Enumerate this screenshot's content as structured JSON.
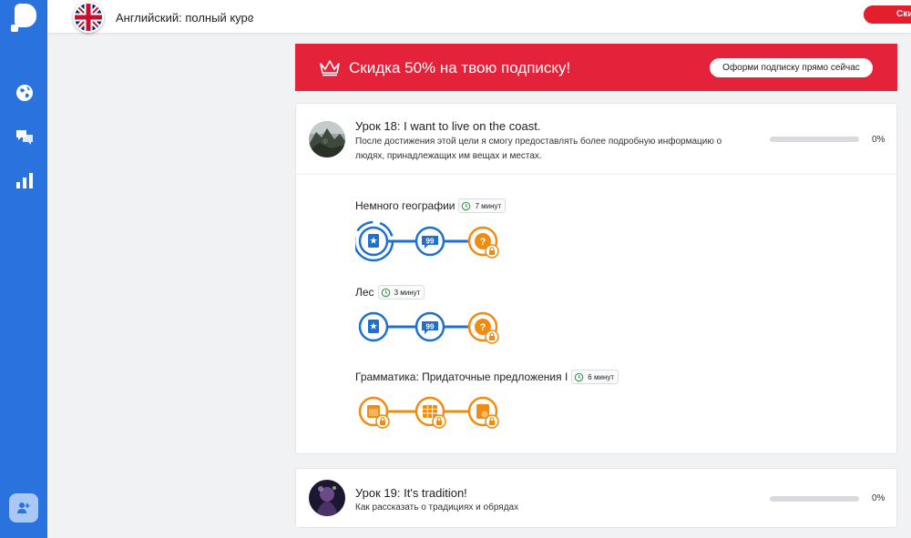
{
  "app": {
    "course_title": "Английский: полный курс",
    "discount_button": "Скидка"
  },
  "promo": {
    "text": "Скидка 50% на твою подписку!",
    "button": "Оформи подписку прямо сейчас"
  },
  "lessons": [
    {
      "title": "Урок 18: I want to live on the coast.",
      "description": "После достижения этой цели я смогу предоставлять более подробную информацию о людях, принадлежащих им вещах и местах.",
      "progress_label": "0%",
      "progress": 0,
      "skills": [
        {
          "name": "Немного географии",
          "time": "7 минут"
        },
        {
          "name": "Лес",
          "time": "3 минут"
        },
        {
          "name": "Грамматика: Придаточные предложения I",
          "time": "6 минут"
        }
      ]
    },
    {
      "title": "Урок 19: It's tradition!",
      "description": "Как рассказать о традициях и обрядах",
      "progress_label": "0%",
      "progress": 0
    }
  ],
  "colors": {
    "rail": "#2a72de",
    "brand_blue": "#1f6fd1",
    "locked_orange": "#f08c12",
    "promo_red": "#e4223a",
    "clock_green": "#3fa34d"
  },
  "icons": [
    "globe-icon",
    "chat-icon",
    "stats-icon",
    "add-user-icon",
    "crown-icon",
    "clock-icon",
    "flashcard-icon",
    "dialog-icon",
    "quiz-icon",
    "lock-icon",
    "grammar-icon"
  ]
}
